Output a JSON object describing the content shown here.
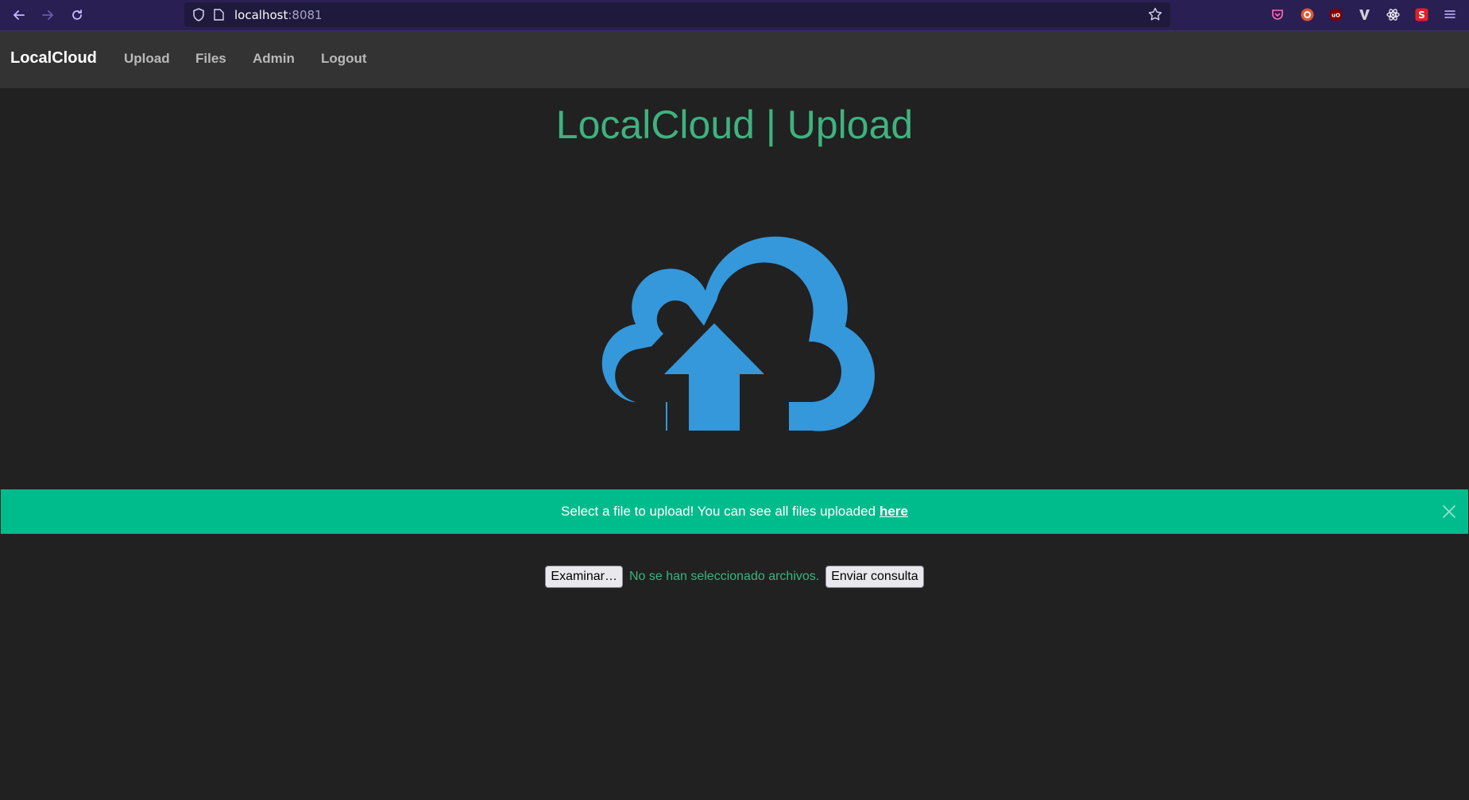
{
  "browser": {
    "url_host": "localhost",
    "url_port": ":8081"
  },
  "nav": {
    "brand": "LocalCloud",
    "links": [
      "Upload",
      "Files",
      "Admin",
      "Logout"
    ]
  },
  "page": {
    "title": "LocalCloud | Upload",
    "icon": "cloud-upload-icon",
    "icon_color": "#3498db"
  },
  "alert": {
    "message": "Select a file to upload! You can see all files uploaded",
    "link_text": "here",
    "color": "#00bc8c"
  },
  "form": {
    "browse_label": "Examinar…",
    "no_file_text": "No se han seleccionado archivos.",
    "submit_label": "Enviar consulta"
  }
}
